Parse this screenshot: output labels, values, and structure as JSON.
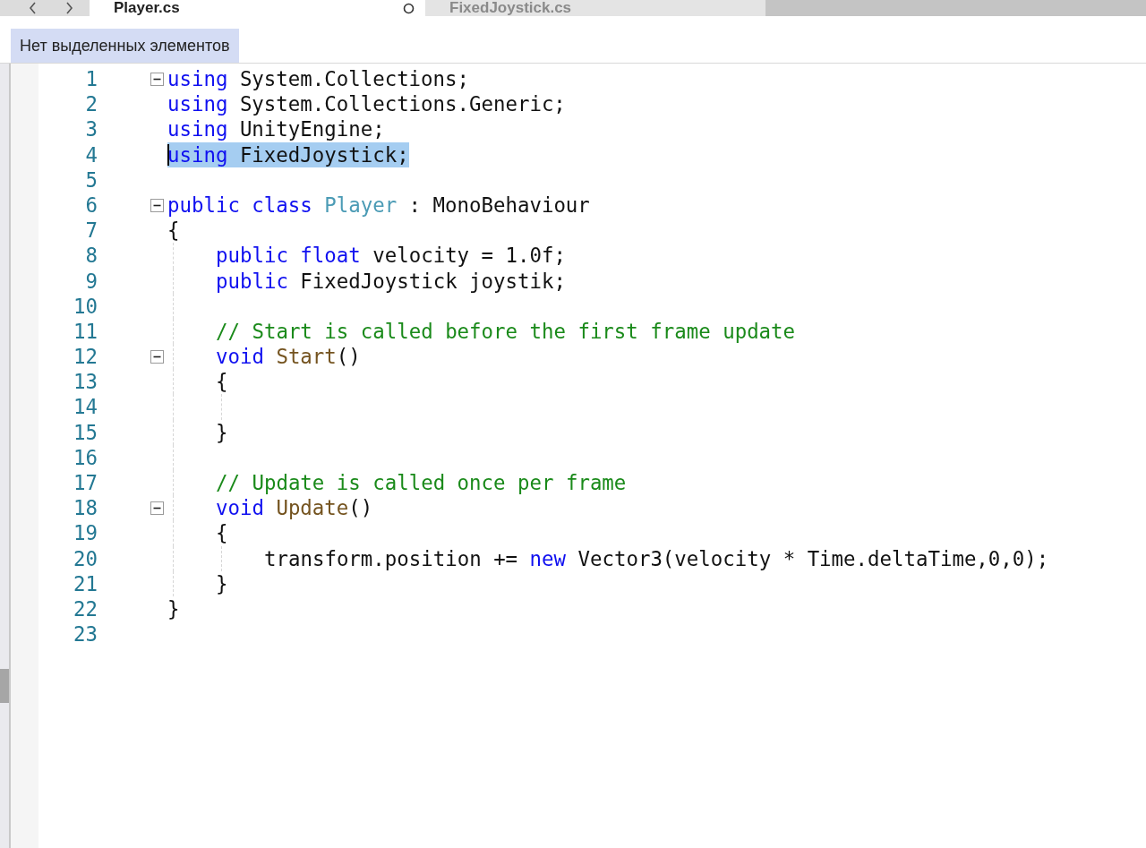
{
  "tabs": [
    {
      "label": "Player.cs",
      "selected": true,
      "modified": true
    },
    {
      "label": "FixedJoystick.cs",
      "selected": false,
      "modified": false
    }
  ],
  "breadcrumb": "Нет выделенных элементов",
  "lines": [
    {
      "number": "1",
      "fold": true,
      "selected": false,
      "tokens": [
        {
          "kind": "keyword",
          "text": "using"
        },
        {
          "kind": "plain",
          "text": " System.Collections;"
        }
      ]
    },
    {
      "number": "2",
      "fold": false,
      "selected": false,
      "tokens": [
        {
          "kind": "keyword",
          "text": "using"
        },
        {
          "kind": "plain",
          "text": " System.Collections.Generic;"
        }
      ]
    },
    {
      "number": "3",
      "fold": false,
      "selected": false,
      "tokens": [
        {
          "kind": "keyword",
          "text": "using"
        },
        {
          "kind": "plain",
          "text": " UnityEngine;"
        }
      ]
    },
    {
      "number": "4",
      "fold": false,
      "selected": true,
      "tokens": [
        {
          "kind": "keyword",
          "text": "using"
        },
        {
          "kind": "plain",
          "text": " FixedJoystick;"
        }
      ]
    },
    {
      "number": "5",
      "fold": false,
      "selected": false
    },
    {
      "number": "6",
      "fold": true,
      "selected": false,
      "tokens": [
        {
          "kind": "keyword",
          "text": "public class"
        },
        {
          "kind": "type",
          "text": " Player"
        },
        {
          "kind": "plain",
          "text": " : MonoBehaviour"
        }
      ]
    },
    {
      "number": "7",
      "fold": false,
      "selected": false,
      "tokens": [
        {
          "kind": "plain",
          "text": "{"
        }
      ],
      "children": [
        {
          "number": "8",
          "fold": false,
          "selected": false,
          "tokens": [
            {
              "kind": "keyword",
              "text": "public float"
            },
            {
              "kind": "plain",
              "text": " velocity = 1.0f;"
            }
          ]
        },
        {
          "number": "9",
          "fold": false,
          "selected": false,
          "tokens": [
            {
              "kind": "keyword",
              "text": "public"
            },
            {
              "kind": "plain",
              "text": " FixedJoystick joystik;"
            }
          ]
        },
        {
          "number": "10",
          "fold": false,
          "selected": false
        },
        {
          "number": "11",
          "fold": false,
          "selected": false,
          "tokens": [
            {
              "kind": "comment",
              "text": "// Start is called before the first frame update"
            }
          ]
        },
        {
          "number": "12",
          "fold": true,
          "selected": false,
          "tokens": [
            {
              "kind": "keyword",
              "text": "void"
            },
            {
              "kind": "method",
              "text": " Start"
            },
            {
              "kind": "plain",
              "text": "()"
            }
          ]
        },
        {
          "number": "13",
          "fold": false,
          "selected": false,
          "tokens": [
            {
              "kind": "plain",
              "text": "{"
            }
          ],
          "children": [
            {
              "number": "14",
              "fold": false,
              "selected": false
            }
          ]
        },
        {
          "number": "15",
          "fold": false,
          "selected": false,
          "tokens": [
            {
              "kind": "plain",
              "text": "}"
            }
          ]
        },
        {
          "number": "16",
          "fold": false,
          "selected": false
        },
        {
          "number": "17",
          "fold": false,
          "selected": false,
          "tokens": [
            {
              "kind": "comment",
              "text": "// Update is called once per frame"
            }
          ]
        },
        {
          "number": "18",
          "fold": true,
          "selected": false,
          "tokens": [
            {
              "kind": "keyword",
              "text": "void"
            },
            {
              "kind": "method",
              "text": " Update"
            },
            {
              "kind": "plain",
              "text": "()"
            }
          ]
        },
        {
          "number": "19",
          "fold": false,
          "selected": false,
          "tokens": [
            {
              "kind": "plain",
              "text": "{"
            }
          ],
          "children": [
            {
              "number": "20",
              "fold": false,
              "selected": false,
              "tokens": [
                {
                  "kind": "plain",
                  "text": "transform.position += "
                },
                {
                  "kind": "keyword",
                  "text": "new"
                },
                {
                  "kind": "plain",
                  "text": " Vector3(velocity * Time.deltaTime,0,0);"
                }
              ]
            }
          ]
        },
        {
          "number": "21",
          "fold": false,
          "selected": false,
          "tokens": [
            {
              "kind": "plain",
              "text": "}"
            }
          ]
        }
      ]
    },
    {
      "number": "22",
      "fold": false,
      "selected": false,
      "tokens": [
        {
          "kind": "plain",
          "text": "}"
        }
      ]
    },
    {
      "number": "23",
      "fold": false,
      "selected": false
    }
  ]
}
